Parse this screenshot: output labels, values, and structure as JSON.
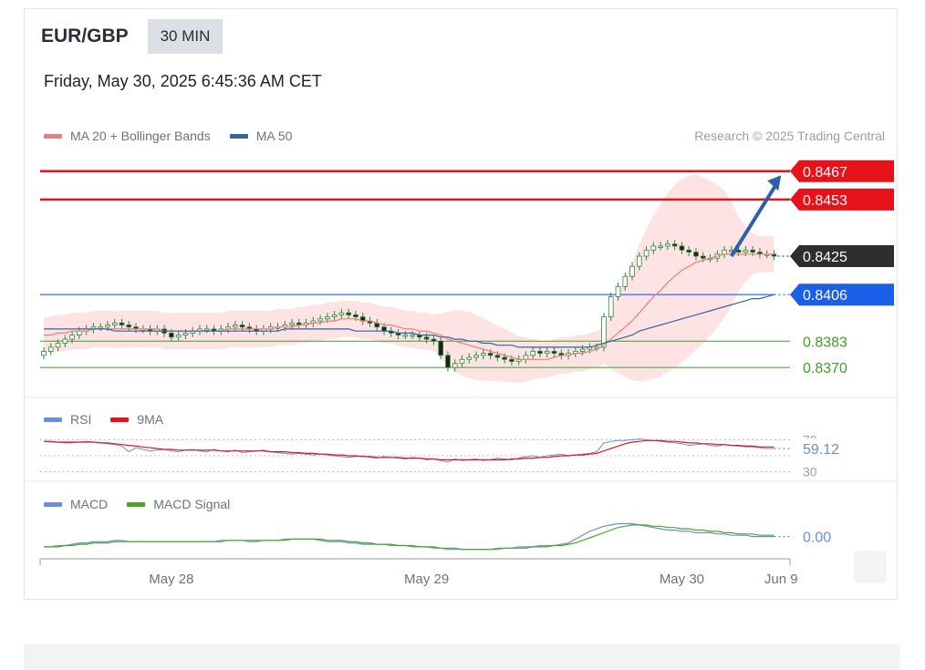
{
  "header": {
    "symbol": "EUR/GBP",
    "timeframe": "30 MIN",
    "datetime": "Friday, May 30, 2025 6:45:36 AM CET"
  },
  "credit": "Research © 2025 Trading Central",
  "colors": {
    "resistance": "#e8121a",
    "pivot": "#1a5fe8",
    "support": "#3e9e2c",
    "last": "#2e2e2e",
    "ma20": "#f07c7c",
    "ma50": "#3561a8",
    "band_fill": "#fde3e3",
    "rsi": "#6b8de0",
    "rsi_ma": "#e8121a",
    "macd": "#6b8de0",
    "macd_signal": "#4aa820",
    "candle": "#2a8a3a"
  },
  "price_panel": {
    "legend": [
      {
        "name": "MA 20 + Bollinger Bands",
        "color": "#f07c7c"
      },
      {
        "name": "MA 50",
        "color": "#3561a8"
      }
    ],
    "ylim": [
      0.8357,
      0.8475
    ],
    "levels": [
      {
        "kind": "resistance",
        "value": 0.8467,
        "label": "0.8467"
      },
      {
        "kind": "resistance",
        "value": 0.8453,
        "label": "0.8453"
      },
      {
        "kind": "last",
        "value": 0.8425,
        "label": "0.8425"
      },
      {
        "kind": "pivot",
        "value": 0.8406,
        "label": "0.8406"
      },
      {
        "kind": "support",
        "value": 0.8383,
        "label": "0.8383"
      },
      {
        "kind": "support",
        "value": 0.837,
        "label": "0.8370"
      }
    ],
    "forecast_arrow": {
      "from": [
        97,
        0.8425
      ],
      "to": [
        104,
        0.8465
      ]
    }
  },
  "chart_data": {
    "type": "line",
    "x_axis_ticks": [
      {
        "index": 18,
        "label": "May 28"
      },
      {
        "index": 54,
        "label": "May 29"
      },
      {
        "index": 90,
        "label": "May 30"
      },
      {
        "index": 104,
        "label": "Jun 9"
      }
    ],
    "x_max": 105,
    "price_close": [
      0.8378,
      0.838,
      0.8382,
      0.8384,
      0.8386,
      0.8388,
      0.8389,
      0.839,
      0.839,
      0.8391,
      0.8392,
      0.8391,
      0.839,
      0.8389,
      0.8389,
      0.8388,
      0.8389,
      0.8387,
      0.8385,
      0.8386,
      0.8387,
      0.8388,
      0.8389,
      0.8389,
      0.8388,
      0.8389,
      0.839,
      0.8391,
      0.839,
      0.8389,
      0.8388,
      0.8389,
      0.839,
      0.839,
      0.8391,
      0.8392,
      0.8391,
      0.8392,
      0.8393,
      0.8394,
      0.8395,
      0.8396,
      0.8397,
      0.8396,
      0.8395,
      0.8393,
      0.8392,
      0.839,
      0.8388,
      0.8387,
      0.8386,
      0.8386,
      0.8386,
      0.8385,
      0.8384,
      0.8383,
      0.8376,
      0.837,
      0.8372,
      0.8374,
      0.8375,
      0.8376,
      0.8377,
      0.8376,
      0.8375,
      0.8374,
      0.8373,
      0.8374,
      0.8376,
      0.8378,
      0.8377,
      0.8378,
      0.8377,
      0.8376,
      0.8377,
      0.8378,
      0.8379,
      0.838,
      0.838,
      0.8395,
      0.8405,
      0.841,
      0.8415,
      0.842,
      0.8425,
      0.8428,
      0.843,
      0.843,
      0.8431,
      0.843,
      0.8428,
      0.8427,
      0.8425,
      0.8424,
      0.8424,
      0.8426,
      0.8428,
      0.8428,
      0.8427,
      0.8428,
      0.8427,
      0.8426,
      0.8426,
      0.8425
    ],
    "ma20": [
      0.8386,
      0.8386,
      0.8387,
      0.8387,
      0.8388,
      0.8388,
      0.8388,
      0.8389,
      0.8389,
      0.8389,
      0.8389,
      0.8389,
      0.8389,
      0.8389,
      0.8389,
      0.8389,
      0.8389,
      0.8388,
      0.8388,
      0.8388,
      0.8388,
      0.8388,
      0.8388,
      0.8388,
      0.8388,
      0.8388,
      0.8389,
      0.8389,
      0.8389,
      0.8389,
      0.8389,
      0.8389,
      0.8389,
      0.839,
      0.839,
      0.839,
      0.8391,
      0.8391,
      0.8392,
      0.8392,
      0.8393,
      0.8393,
      0.8394,
      0.8394,
      0.8394,
      0.8393,
      0.8393,
      0.8392,
      0.8391,
      0.8391,
      0.839,
      0.8389,
      0.8389,
      0.8388,
      0.8388,
      0.8387,
      0.8386,
      0.8384,
      0.8383,
      0.8382,
      0.8381,
      0.838,
      0.8379,
      0.8378,
      0.8377,
      0.8376,
      0.8375,
      0.8374,
      0.8374,
      0.8374,
      0.8374,
      0.8374,
      0.8375,
      0.8376,
      0.8376,
      0.8377,
      0.8377,
      0.8378,
      0.8379,
      0.8381,
      0.8384,
      0.8387,
      0.839,
      0.8393,
      0.8397,
      0.8401,
      0.8405,
      0.8408,
      0.8412,
      0.8415,
      0.8418,
      0.842,
      0.8422,
      0.8423,
      0.8424,
      0.8425,
      0.8426,
      0.8426,
      0.8426,
      0.8426,
      0.8426,
      0.8426,
      0.8426,
      0.8426
    ],
    "ma50": [
      0.8389,
      0.8389,
      0.8389,
      0.8389,
      0.8389,
      0.8389,
      0.8389,
      0.8389,
      0.8389,
      0.8389,
      0.8388,
      0.8388,
      0.8388,
      0.8388,
      0.8388,
      0.8388,
      0.8388,
      0.8388,
      0.8388,
      0.8388,
      0.8388,
      0.8388,
      0.8388,
      0.8388,
      0.8388,
      0.8388,
      0.8388,
      0.8388,
      0.8388,
      0.8388,
      0.8388,
      0.8388,
      0.8388,
      0.8388,
      0.8389,
      0.8389,
      0.8389,
      0.8389,
      0.8389,
      0.8389,
      0.8389,
      0.8389,
      0.8389,
      0.8389,
      0.8388,
      0.8388,
      0.8388,
      0.8388,
      0.8388,
      0.8388,
      0.8387,
      0.8387,
      0.8387,
      0.8386,
      0.8386,
      0.8386,
      0.8385,
      0.8385,
      0.8384,
      0.8384,
      0.8383,
      0.8383,
      0.8382,
      0.8382,
      0.8381,
      0.8381,
      0.8381,
      0.838,
      0.838,
      0.838,
      0.838,
      0.838,
      0.838,
      0.838,
      0.838,
      0.838,
      0.838,
      0.838,
      0.8381,
      0.8382,
      0.8383,
      0.8384,
      0.8385,
      0.8386,
      0.8388,
      0.8389,
      0.839,
      0.8391,
      0.8392,
      0.8393,
      0.8394,
      0.8395,
      0.8396,
      0.8397,
      0.8398,
      0.8399,
      0.84,
      0.8401,
      0.8402,
      0.8403,
      0.8404,
      0.8404,
      0.8405,
      0.8406
    ],
    "rsi_panel": {
      "legend": [
        {
          "name": "RSI",
          "color": "#6b8de0"
        },
        {
          "name": "9MA",
          "color": "#e8121a"
        }
      ],
      "ylim": [
        25,
        75
      ],
      "levels": [
        {
          "value": 70,
          "label": "70"
        },
        {
          "value": 50,
          "label": ""
        },
        {
          "value": 30,
          "label": "30"
        }
      ],
      "last_label": "59.12",
      "rsi": [
        68,
        67,
        67,
        66,
        66,
        67,
        68,
        67,
        66,
        65,
        64,
        62,
        55,
        60,
        58,
        56,
        57,
        58,
        56,
        55,
        57,
        58,
        56,
        55,
        58,
        56,
        55,
        57,
        54,
        55,
        56,
        57,
        55,
        54,
        53,
        52,
        53,
        52,
        51,
        52,
        51,
        50,
        49,
        48,
        49,
        50,
        48,
        47,
        49,
        48,
        47,
        46,
        48,
        47,
        45,
        46,
        44,
        42,
        46,
        44,
        45,
        46,
        44,
        45,
        47,
        46,
        45,
        47,
        49,
        50,
        48,
        50,
        51,
        52,
        50,
        51,
        52,
        53,
        55,
        66,
        68,
        69,
        69,
        70,
        71,
        70,
        69,
        68,
        67,
        66,
        65,
        63,
        64,
        65,
        63,
        62,
        64,
        63,
        62,
        61,
        61,
        60,
        59,
        59.12
      ],
      "rsi_ma": [
        68,
        68,
        67,
        67,
        67,
        67,
        67,
        67,
        66,
        66,
        65,
        64,
        63,
        62,
        61,
        60,
        59,
        58,
        58,
        57,
        57,
        57,
        57,
        57,
        57,
        56,
        56,
        56,
        56,
        56,
        56,
        56,
        55,
        55,
        55,
        54,
        54,
        53,
        53,
        52,
        52,
        51,
        51,
        50,
        50,
        49,
        49,
        48,
        48,
        48,
        48,
        47,
        47,
        47,
        46,
        46,
        45,
        45,
        45,
        45,
        45,
        45,
        45,
        45,
        45,
        45,
        46,
        46,
        47,
        47,
        48,
        48,
        49,
        50,
        50,
        51,
        51,
        52,
        53,
        56,
        59,
        62,
        65,
        67,
        68,
        69,
        69,
        69,
        68,
        68,
        67,
        66,
        66,
        65,
        65,
        64,
        64,
        63,
        63,
        62,
        62,
        61,
        61,
        61
      ]
    },
    "macd_panel": {
      "legend": [
        {
          "name": "MACD",
          "color": "#6b8de0"
        },
        {
          "name": "MACD Signal",
          "color": "#4aa820"
        }
      ],
      "ylim": [
        -0.0012,
        0.0022
      ],
      "last_label": "0.00",
      "macd": [
        -0.0002,
        -0.0002,
        -0.0001,
        -0.0001,
        0,
        0.0001,
        0.0001,
        0.0002,
        0.0002,
        0.0002,
        0.0003,
        0.0003,
        0.0002,
        0.0002,
        0.0002,
        0.0002,
        0.0002,
        0.0002,
        0.0002,
        0.0002,
        0.0002,
        0.0002,
        0.0002,
        0.0002,
        0.0002,
        0.0003,
        0.0003,
        0.0003,
        0.0003,
        0.0002,
        0.0002,
        0.0003,
        0.0003,
        0.0003,
        0.0004,
        0.0004,
        0.0004,
        0.0004,
        0.0004,
        0.0003,
        0.0002,
        0.0002,
        0.0002,
        0.0001,
        0.0001,
        0,
        0,
        0,
        0,
        -0.0001,
        -0.0001,
        -0.0001,
        -0.0002,
        -0.0002,
        -0.0002,
        -0.0003,
        -0.0003,
        -0.0004,
        -0.0004,
        -0.0004,
        -0.0004,
        -0.0004,
        -0.0004,
        -0.0004,
        -0.0003,
        -0.0003,
        -0.0003,
        -0.0002,
        -0.0002,
        -0.0002,
        -0.0001,
        -0.0001,
        -0.0001,
        0,
        0.0001,
        0.0004,
        0.0007,
        0.001,
        0.0012,
        0.0014,
        0.0015,
        0.0016,
        0.0016,
        0.0016,
        0.0015,
        0.0014,
        0.0013,
        0.0012,
        0.0011,
        0.0011,
        0.001,
        0.001,
        0.0009,
        0.0009,
        0.0009,
        0.0008,
        0.0008,
        0.0007,
        0.0007,
        0.0007,
        0.0006,
        0.0006,
        0.0006,
        0.0006
      ],
      "signal": [
        -0.0002,
        -0.0002,
        -0.0002,
        -0.0001,
        -0.0001,
        0,
        0,
        0.0001,
        0.0001,
        0.0001,
        0.0002,
        0.0002,
        0.0002,
        0.0002,
        0.0002,
        0.0002,
        0.0002,
        0.0002,
        0.0002,
        0.0002,
        0.0002,
        0.0002,
        0.0002,
        0.0002,
        0.0002,
        0.0002,
        0.0003,
        0.0003,
        0.0003,
        0.0003,
        0.0003,
        0.0003,
        0.0003,
        0.0003,
        0.0003,
        0.0004,
        0.0004,
        0.0004,
        0.0004,
        0.0004,
        0.0003,
        0.0003,
        0.0003,
        0.0002,
        0.0002,
        0.0001,
        0.0001,
        0,
        0,
        0,
        -0.0001,
        -0.0001,
        -0.0001,
        -0.0002,
        -0.0002,
        -0.0002,
        -0.0003,
        -0.0003,
        -0.0003,
        -0.0004,
        -0.0004,
        -0.0004,
        -0.0004,
        -0.0004,
        -0.0004,
        -0.0003,
        -0.0003,
        -0.0003,
        -0.0003,
        -0.0002,
        -0.0002,
        -0.0002,
        -0.0001,
        -0.0001,
        0,
        0.0001,
        0.0003,
        0.0005,
        0.0007,
        0.0009,
        0.0011,
        0.0013,
        0.0014,
        0.0015,
        0.0015,
        0.0015,
        0.0014,
        0.0014,
        0.0013,
        0.0013,
        0.0012,
        0.0012,
        0.0011,
        0.0011,
        0.001,
        0.001,
        0.0009,
        0.0009,
        0.0008,
        0.0008,
        0.0008,
        0.0007,
        0.0007,
        0.0007
      ]
    }
  }
}
